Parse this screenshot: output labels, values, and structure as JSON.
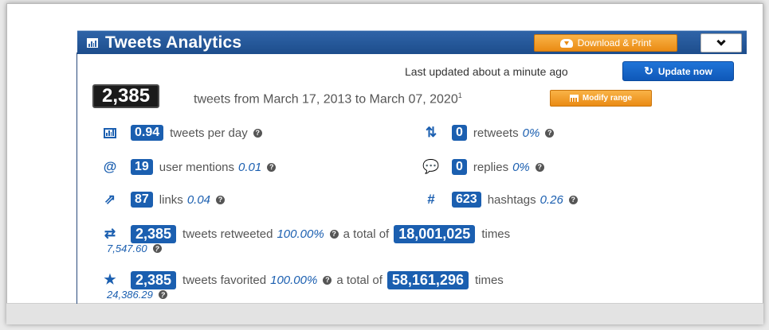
{
  "header": {
    "title": "Tweets Analytics",
    "download_label": "Download & Print"
  },
  "status": {
    "last_updated": "Last updated about a minute ago",
    "update_label": "Update now"
  },
  "summary": {
    "tweet_count": "2,385",
    "range_text": "tweets from March 17, 2013 to March 07, 2020",
    "range_footnote": "1",
    "modify_label": "Modify range"
  },
  "stats": {
    "per_day": {
      "value": "0.94",
      "label": "tweets per day"
    },
    "retweets": {
      "value": "0",
      "label": "retweets",
      "pct": "0%"
    },
    "mentions": {
      "value": "19",
      "label": "user mentions",
      "ratio": "0.01"
    },
    "replies": {
      "value": "0",
      "label": "replies",
      "pct": "0%"
    },
    "links": {
      "value": "87",
      "label": "links",
      "ratio": "0.04"
    },
    "hashtags": {
      "value": "623",
      "label": "hashtags",
      "ratio": "0.26"
    },
    "retweeted": {
      "value": "2,385",
      "label": "tweets retweeted",
      "pct": "100.00%",
      "total_prefix": "a total of",
      "total": "18,001,025",
      "suffix": "times",
      "avg": "7,547.60"
    },
    "favorited": {
      "value": "2,385",
      "label": "tweets favorited",
      "pct": "100.00%",
      "total_prefix": "a total of",
      "total": "58,161,296",
      "suffix": "times",
      "avg": "24,386.29"
    }
  },
  "colors": {
    "header_blue": "#1d4d8c",
    "accent_blue": "#1b5fb0",
    "orange": "#ea8b14",
    "dark_badge": "#1b1b1b"
  }
}
